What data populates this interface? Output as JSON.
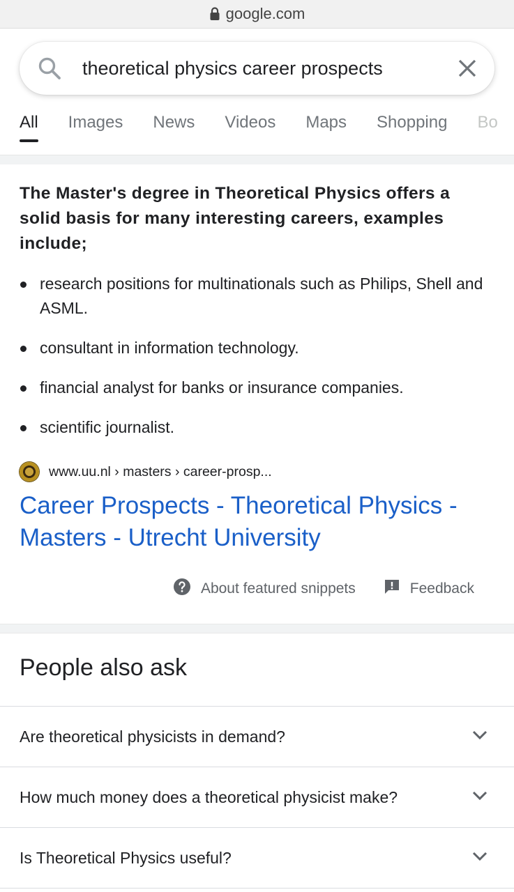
{
  "url_bar": {
    "domain": "google.com",
    "icon": "lock-icon"
  },
  "search": {
    "query": "theoretical physics career prospects",
    "icon": "search-icon",
    "clear_icon": "close-icon"
  },
  "tabs": [
    {
      "label": "All",
      "active": true
    },
    {
      "label": "Images"
    },
    {
      "label": "News"
    },
    {
      "label": "Videos"
    },
    {
      "label": "Maps"
    },
    {
      "label": "Shopping"
    },
    {
      "label": "Bo"
    }
  ],
  "snippet": {
    "heading": "The Master's degree in Theoretical Physics offers a solid basis for many interesting careers, examples include;",
    "bullets": [
      "research positions for multinationals such as Philips, Shell and ASML.",
      "consultant in information technology.",
      "financial analyst for banks or insurance companies.",
      "scientific journalist."
    ],
    "source": {
      "breadcrumb": "www.uu.nl › masters › career-prosp...",
      "favicon": "utrecht-university-seal-icon"
    },
    "title": "Career Prospects - Theoretical Physics - Masters - Utrecht University",
    "footer": {
      "about": "About featured snippets",
      "feedback": "Feedback"
    }
  },
  "people_also_ask": {
    "title": "People also ask",
    "questions": [
      "Are theoretical physicists in demand?",
      "How much money does a theoretical physicist make?",
      "Is Theoretical Physics useful?"
    ]
  },
  "colors": {
    "link": "#1a5fc8",
    "text": "#202124",
    "muted": "#70757a"
  }
}
